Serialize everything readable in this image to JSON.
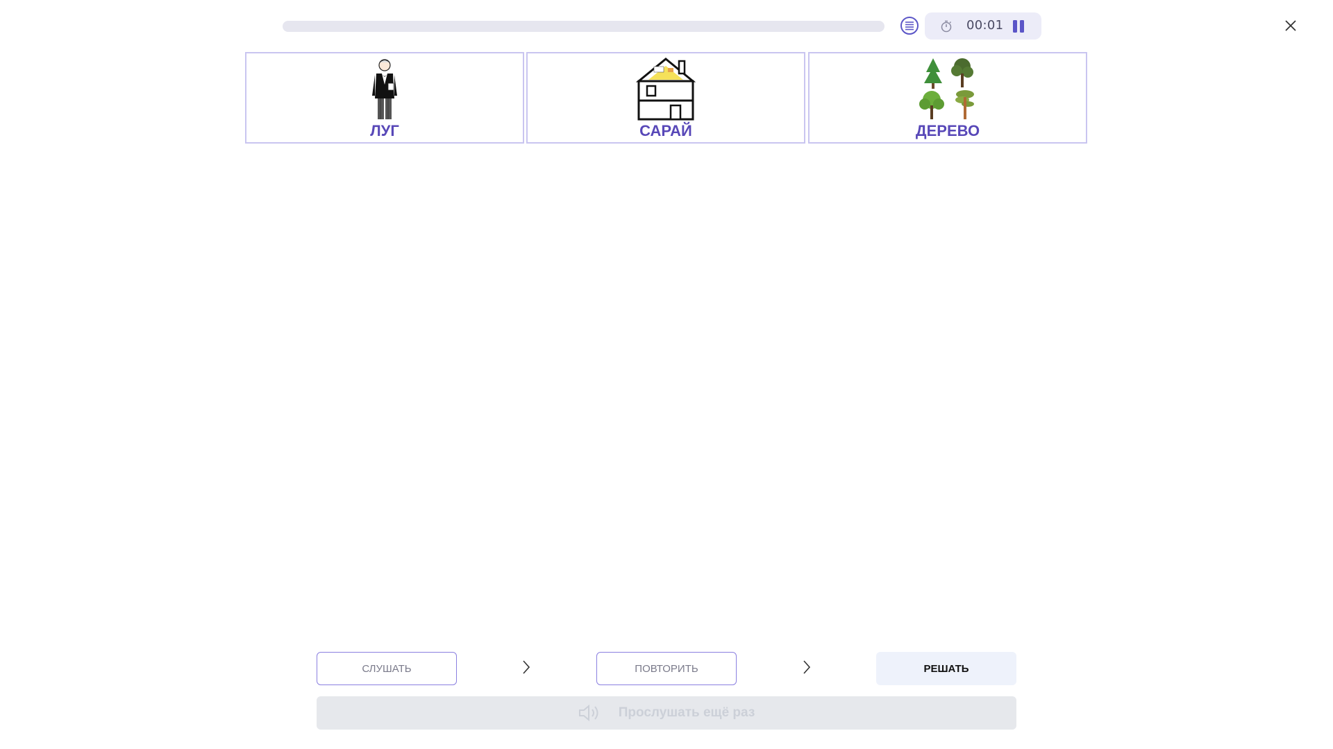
{
  "header": {
    "progress_percent": 0,
    "timer": "00:01"
  },
  "cards": [
    {
      "label": "ЛУГ",
      "icon": "man-in-tuxedo-picture"
    },
    {
      "label": "САРАЙ",
      "icon": "house-picture"
    },
    {
      "label": "ДЕРЕВО",
      "icon": "trees-picture"
    }
  ],
  "steps": {
    "listen": "СЛУШАТЬ",
    "repeat": "ПОВТОРИТЬ",
    "solve": "РЕШАТЬ"
  },
  "replay": {
    "label": "Прослушать ещё раз",
    "enabled": false
  },
  "colors": {
    "accent": "#5b55c7",
    "card_label": "#5848b8",
    "card_border": "#c9c5f0"
  }
}
